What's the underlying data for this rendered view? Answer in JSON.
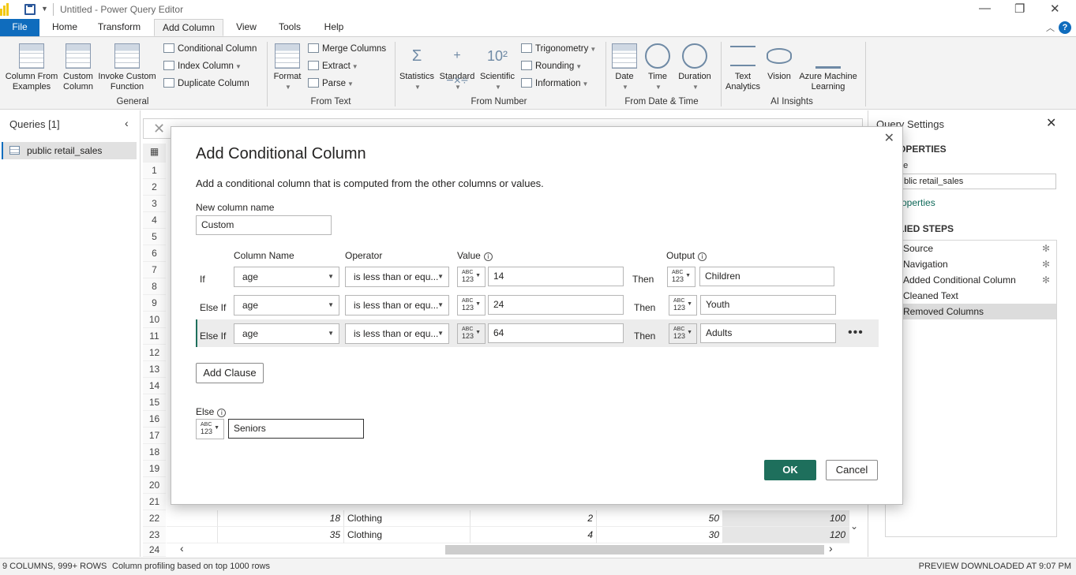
{
  "window": {
    "title": "Untitled - Power Query Editor"
  },
  "tabs": [
    "File",
    "Home",
    "Transform",
    "Add Column",
    "View",
    "Tools",
    "Help"
  ],
  "ribbon": {
    "general": {
      "label": "General",
      "column_from_examples": "Column From Examples",
      "custom_column": "Custom Column",
      "invoke_custom_function": "Invoke Custom Function",
      "conditional_column": "Conditional Column",
      "index_column": "Index Column",
      "duplicate_column": "Duplicate Column"
    },
    "from_text": {
      "label": "From Text",
      "format": "Format",
      "merge_columns": "Merge Columns",
      "extract": "Extract",
      "parse": "Parse"
    },
    "from_number": {
      "label": "From Number",
      "statistics": "Statistics",
      "standard": "Standard",
      "scientific": "Scientific",
      "trigonometry": "Trigonometry",
      "rounding": "Rounding",
      "information": "Information"
    },
    "from_date_time": {
      "label": "From Date & Time",
      "date": "Date",
      "time": "Time",
      "duration": "Duration"
    },
    "ai_insights": {
      "label": "AI Insights",
      "text_analytics": "Text Analytics",
      "vision": "Vision",
      "azure_ml": "Azure Machine Learning"
    }
  },
  "queries": {
    "header": "Queries [1]",
    "items": [
      "public retail_sales"
    ]
  },
  "grid": {
    "row_numbers": [
      "1",
      "2",
      "3",
      "4",
      "5",
      "6",
      "7",
      "8",
      "9",
      "10",
      "11",
      "12",
      "13",
      "14",
      "15",
      "16",
      "17",
      "18",
      "19",
      "20",
      "21",
      "22",
      "23",
      "24"
    ],
    "visible_rows": [
      {
        "age": "18",
        "category": "Clothing",
        "qty": "2",
        "price": "50",
        "total": "100"
      },
      {
        "age": "35",
        "category": "Clothing",
        "qty": "4",
        "price": "30",
        "total": "120"
      }
    ]
  },
  "settings": {
    "header": "Query Settings",
    "properties_header": "OPERTIES",
    "name_label": "ne",
    "name_value": "blic retail_sales",
    "all_properties_link": "roperties",
    "applied_steps_header": "LIED STEPS",
    "steps": [
      "Source",
      "Navigation",
      "Added Conditional Column",
      "Cleaned Text",
      "Removed Columns"
    ]
  },
  "status": {
    "columns_rows": "9 COLUMNS, 999+ ROWS",
    "profiling": "Column profiling based on top 1000 rows",
    "preview": "PREVIEW DOWNLOADED AT 9:07 PM"
  },
  "dialog": {
    "title": "Add Conditional Column",
    "description": "Add a conditional column that is computed from the other columns or values.",
    "new_column_label": "New column name",
    "new_column_value": "Custom",
    "headers": {
      "column_name": "Column Name",
      "operator": "Operator",
      "value": "Value",
      "output": "Output"
    },
    "clauses": [
      {
        "label": "If",
        "column": "age",
        "operator": "is less than or equ...",
        "value": "14",
        "then": "Then",
        "output": "Children"
      },
      {
        "label": "Else If",
        "column": "age",
        "operator": "is less than or equ...",
        "value": "24",
        "then": "Then",
        "output": "Youth"
      },
      {
        "label": "Else If",
        "column": "age",
        "operator": "is less than or equ...",
        "value": "64",
        "then": "Then",
        "output": "Adults"
      }
    ],
    "type_label_top": "ABC",
    "type_label_bottom": "123",
    "add_clause": "Add Clause",
    "else_label": "Else",
    "else_value": "Seniors",
    "ok": "OK",
    "cancel": "Cancel"
  }
}
